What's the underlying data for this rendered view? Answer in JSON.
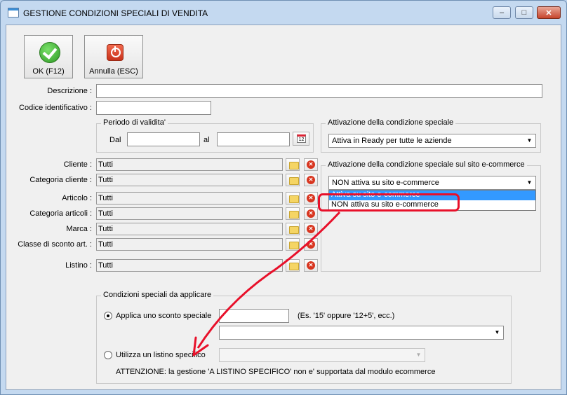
{
  "window": {
    "title": "GESTIONE CONDIZIONI SPECIALI DI VENDITA",
    "minimize": "–",
    "maximize": "□",
    "close": "✕"
  },
  "toolbar": {
    "ok_label": "OK (F12)",
    "cancel_label": "Annulla (ESC)"
  },
  "form": {
    "descrizione_label": "Descrizione :",
    "descrizione_value": "",
    "codice_label": "Codice identificativo :",
    "codice_value": ""
  },
  "periodo": {
    "title": "Periodo di validita'",
    "dal_label": "Dal",
    "al_label": "al",
    "dal_value": "",
    "al_value": ""
  },
  "attivazione": {
    "title": "Attivazione della condizione speciale",
    "value": "Attiva in Ready per tutte le aziende"
  },
  "attivazione_ecom": {
    "title": "Attivazione della condizione speciale sul sito e-commerce",
    "value": "NON attiva su sito e-commerce",
    "options": [
      "Attiva su sito e-commerce",
      "NON attiva su sito e-commerce"
    ]
  },
  "filters": [
    {
      "label": "Cliente :",
      "value": "Tutti"
    },
    {
      "label": "Categoria cliente :",
      "value": "Tutti"
    },
    {
      "label": "Articolo :",
      "value": "Tutti"
    },
    {
      "label": "Categoria articoli :",
      "value": "Tutti"
    },
    {
      "label": "Marca :",
      "value": "Tutti"
    },
    {
      "label": "Classe di sconto art. :",
      "value": "Tutti"
    },
    {
      "label": "Listino :",
      "value": "Tutti"
    }
  ],
  "condizioni": {
    "title": "Condizioni speciali da applicare",
    "sconto_label": "Applica uno sconto speciale",
    "sconto_value": "",
    "sconto_hint": "(Es. '15' oppure '12+5', ecc.)",
    "sconto_combo": "",
    "listino_label": "Utilizza un listino specifico",
    "listino_combo": "",
    "warning": "ATTENZIONE: la gestione 'A LISTINO SPECIFICO' non e' supportata dal modulo ecommerce"
  },
  "colors": {
    "annotation": "#e8102a",
    "selection": "#3399ff"
  }
}
